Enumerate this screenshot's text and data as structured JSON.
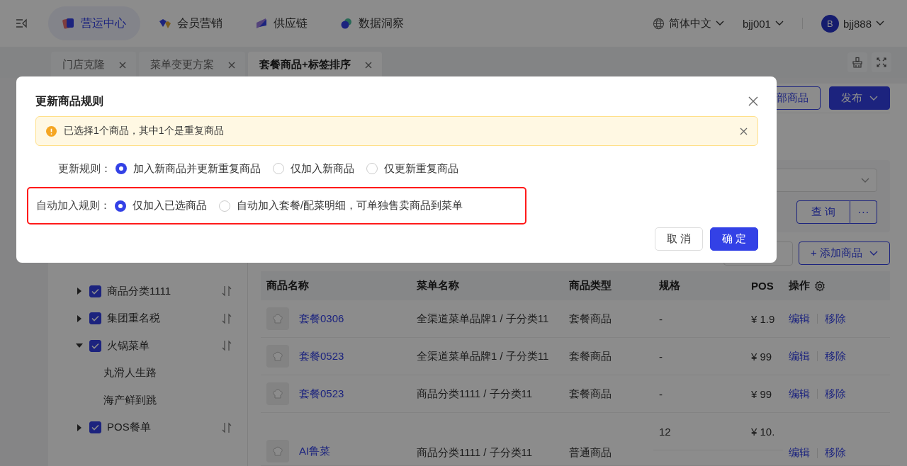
{
  "top_nav": {
    "items": [
      {
        "label": "营运中心",
        "selected": true
      },
      {
        "label": "会员营销",
        "selected": false
      },
      {
        "label": "供应链",
        "selected": false
      },
      {
        "label": "数据洞察",
        "selected": false
      }
    ],
    "language": "简体中文",
    "org": "bjj001",
    "user": {
      "avatar": "B",
      "name": "bjj888"
    }
  },
  "tabs": [
    {
      "label": "门店克隆",
      "selected": false
    },
    {
      "label": "菜单变更方案",
      "selected": false
    },
    {
      "label": "套餐商品+标签排序",
      "selected": true
    }
  ],
  "toolbar": {
    "buttons": [
      {
        "label": "部商品",
        "kind": "outline"
      },
      {
        "label": "发布",
        "kind": "primary"
      }
    ]
  },
  "filter": {
    "query_button": "查 询",
    "more_button": "···"
  },
  "add_button": "+ 添加商品",
  "tree": [
    {
      "label": "商品分类1111",
      "checked": true,
      "expanded": false
    },
    {
      "label": "集团重名税",
      "checked": true,
      "expanded": false
    },
    {
      "label": "火锅菜单",
      "checked": true,
      "expanded": true,
      "children": [
        {
          "label": "丸滑人生路"
        },
        {
          "label": "海产鲜到跳"
        }
      ]
    },
    {
      "label": "POS餐单",
      "checked": true,
      "expanded": false
    }
  ],
  "table": {
    "columns": [
      "商品名称",
      "菜单名称",
      "商品类型",
      "规格",
      "POS",
      "操作"
    ],
    "rows": [
      {
        "kind": "single",
        "name": "套餐0306",
        "menu": "全渠道菜单品牌1 / 子分类11",
        "type": "套餐商品",
        "spec": "-",
        "pos": "¥ 1.9",
        "actions": [
          "编辑",
          "移除"
        ]
      },
      {
        "kind": "single",
        "name": "套餐0523",
        "menu": "全渠道菜单品牌1 / 子分类11",
        "type": "套餐商品",
        "spec": "-",
        "pos": "¥ 99",
        "actions": [
          "编辑",
          "移除"
        ]
      },
      {
        "kind": "single",
        "name": "套餐0523",
        "menu": "商品分类1111 / 子分类11",
        "type": "套餐商品",
        "spec": "-",
        "pos": "¥ 99",
        "actions": [
          "编辑",
          "移除"
        ]
      },
      {
        "kind": "multi",
        "name": "AI鲁菜",
        "menu": "商品分类1111 / 子分类11",
        "type": "普通商品",
        "spec": "12",
        "pos": "¥ 10.",
        "actions": [
          "编辑",
          "移除"
        ]
      }
    ]
  },
  "dialog": {
    "title": "更新商品规则",
    "alert": "已选择1个商品，其中1个是重复商品",
    "rules": [
      {
        "label": "更新规则：",
        "highlighted": false,
        "options": [
          {
            "label": "加入新商品并更新重复商品",
            "selected": true
          },
          {
            "label": "仅加入新商品",
            "selected": false
          },
          {
            "label": "仅更新重复商品",
            "selected": false
          }
        ]
      },
      {
        "label": "自动加入规则：",
        "highlighted": true,
        "options": [
          {
            "label": "仅加入已选商品",
            "selected": true
          },
          {
            "label": "自动加入套餐/配菜明细，可单独售卖商品到菜单",
            "selected": false
          }
        ]
      }
    ],
    "buttons": [
      {
        "label": "取 消",
        "kind": "default"
      },
      {
        "label": "确 定",
        "kind": "primary"
      }
    ]
  }
}
